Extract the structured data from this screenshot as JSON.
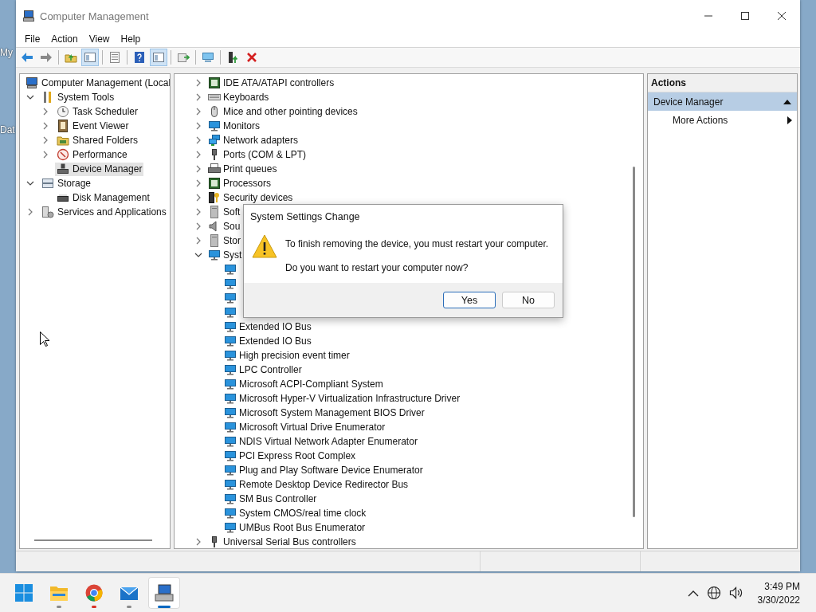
{
  "desktop": {
    "labels": [
      "My",
      "Dat"
    ]
  },
  "window": {
    "title": "Computer Management",
    "menu": [
      "File",
      "Action",
      "View",
      "Help"
    ],
    "toolbar": [
      {
        "kind": "back",
        "pressed": false
      },
      {
        "kind": "forward",
        "pressed": false
      },
      {
        "kind": "separator"
      },
      {
        "kind": "up",
        "pressed": false
      },
      {
        "kind": "tree",
        "pressed": true
      },
      {
        "kind": "separator"
      },
      {
        "kind": "properties",
        "pressed": false
      },
      {
        "kind": "separator"
      },
      {
        "kind": "help",
        "pressed": false
      },
      {
        "kind": "actionpane",
        "pressed": true
      },
      {
        "kind": "separator"
      },
      {
        "kind": "export",
        "pressed": false
      },
      {
        "kind": "separator"
      },
      {
        "kind": "connect",
        "pressed": false
      },
      {
        "kind": "separator"
      },
      {
        "kind": "scan",
        "pressed": false
      },
      {
        "kind": "uninstall",
        "pressed": false
      }
    ]
  },
  "tree": [
    {
      "label": "Computer Management (Local",
      "kind": "computer",
      "selected": false,
      "children": [
        {
          "label": "System Tools",
          "kind": "tools",
          "expanded": true,
          "selected": false,
          "children": [
            {
              "label": "Task Scheduler",
              "kind": "clock",
              "expanded": false,
              "selected": false
            },
            {
              "label": "Event Viewer",
              "kind": "event",
              "expanded": false,
              "selected": false
            },
            {
              "label": "Shared Folders",
              "kind": "folder",
              "expanded": false,
              "selected": false
            },
            {
              "label": "Performance",
              "kind": "gauge",
              "expanded": false,
              "selected": false
            },
            {
              "label": "Device Manager",
              "kind": "devmgr",
              "selected": true
            }
          ]
        },
        {
          "label": "Storage",
          "kind": "storage",
          "expanded": true,
          "selected": false,
          "children": [
            {
              "label": "Disk Management",
              "kind": "disk",
              "selected": false
            }
          ]
        },
        {
          "label": "Services and Applications",
          "kind": "services",
          "expanded": false,
          "selected": false
        }
      ]
    }
  ],
  "devices": [
    {
      "label": "IDE ATA/ATAPI controllers",
      "kind": "ide",
      "expanded": false
    },
    {
      "label": "Keyboards",
      "kind": "keyboard",
      "expanded": false
    },
    {
      "label": "Mice and other pointing devices",
      "kind": "mouse",
      "expanded": false
    },
    {
      "label": "Monitors",
      "kind": "monitor",
      "expanded": false
    },
    {
      "label": "Network adapters",
      "kind": "network",
      "expanded": false
    },
    {
      "label": "Ports (COM & LPT)",
      "kind": "port",
      "expanded": false
    },
    {
      "label": "Print queues",
      "kind": "printer",
      "expanded": false
    },
    {
      "label": "Processors",
      "kind": "processor",
      "expanded": false
    },
    {
      "label": "Security devices",
      "kind": "security",
      "expanded": false
    },
    {
      "label": "Soft",
      "kind": "software",
      "expanded": false
    },
    {
      "label": "Sou",
      "kind": "sound",
      "expanded": false
    },
    {
      "label": "Stor",
      "kind": "storage",
      "expanded": false
    },
    {
      "label": "Syst",
      "kind": "system",
      "expanded": true,
      "children": [
        {
          "kind": "covered"
        },
        {
          "kind": "covered"
        },
        {
          "kind": "covered"
        },
        {
          "kind": "covered"
        },
        {
          "kind": "device",
          "label": "Extended IO Bus"
        },
        {
          "kind": "device",
          "label": "Extended IO Bus"
        },
        {
          "kind": "device",
          "label": "High precision event timer"
        },
        {
          "kind": "device",
          "label": "LPC Controller"
        },
        {
          "kind": "device",
          "label": "Microsoft ACPI-Compliant System"
        },
        {
          "kind": "device",
          "label": "Microsoft Hyper-V Virtualization Infrastructure Driver"
        },
        {
          "kind": "device",
          "label": "Microsoft System Management BIOS Driver"
        },
        {
          "kind": "device",
          "label": "Microsoft Virtual Drive Enumerator"
        },
        {
          "kind": "device",
          "label": "NDIS Virtual Network Adapter Enumerator"
        },
        {
          "kind": "device",
          "label": "PCI Express Root Complex"
        },
        {
          "kind": "device",
          "label": "Plug and Play Software Device Enumerator"
        },
        {
          "kind": "device",
          "label": "Remote Desktop Device Redirector Bus"
        },
        {
          "kind": "device",
          "label": "SM Bus Controller"
        },
        {
          "kind": "device",
          "label": "System CMOS/real time clock"
        },
        {
          "kind": "device",
          "label": "UMBus Root Bus Enumerator"
        }
      ]
    },
    {
      "label": "Universal Serial Bus controllers",
      "kind": "usb",
      "expanded": false
    }
  ],
  "actions": {
    "title": "Actions",
    "items": [
      {
        "label": "Device Manager",
        "kind": "section",
        "expanded": true
      },
      {
        "label": "More Actions",
        "kind": "submenu"
      }
    ]
  },
  "dialog": {
    "title": "System Settings Change",
    "message": "To finish removing the device, you must restart your computer.",
    "question": "Do you want to restart your computer now?",
    "buttons": [
      {
        "label": "Yes",
        "focused": true
      },
      {
        "label": "No",
        "focused": false
      }
    ]
  },
  "taskbar": {
    "apps": [
      {
        "kind": "start",
        "running": false,
        "active": false
      },
      {
        "kind": "explorer",
        "running": true,
        "active": false,
        "color": "#8a8a8a"
      },
      {
        "kind": "browser",
        "running": true,
        "active": false,
        "color": "#d93025"
      },
      {
        "kind": "mail",
        "running": true,
        "active": false,
        "color": "#8a8a8a"
      },
      {
        "kind": "compmgmt",
        "running": true,
        "active": true,
        "color": "#0067c0"
      }
    ],
    "time": "3:49 PM",
    "date": "3/30/2022"
  }
}
